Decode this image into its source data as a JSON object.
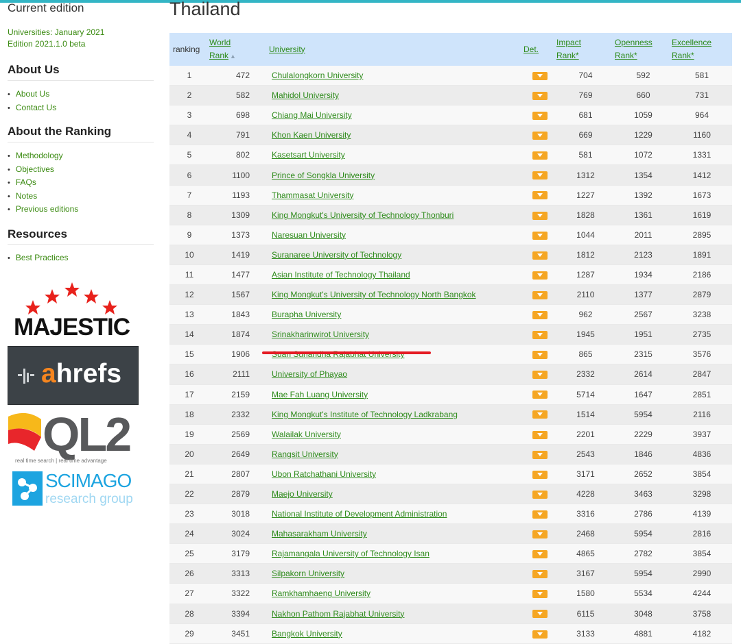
{
  "sidebar": {
    "edition_title": "Current edition",
    "edition_line1": "Universities: January 2021",
    "edition_line2": "Edition 2021.1.0 beta",
    "about_us": {
      "heading": "About Us",
      "items": [
        "About Us",
        "Contact Us"
      ]
    },
    "about_ranking": {
      "heading": "About the Ranking",
      "items": [
        "Methodology",
        "Objectives",
        "FAQs",
        "Notes",
        "Previous editions"
      ]
    },
    "resources": {
      "heading": "Resources",
      "items": [
        "Best Practices"
      ]
    },
    "logos": {
      "majestic": "MAJESTIC",
      "ahrefs_a": "a",
      "ahrefs_rest": "hrefs",
      "ql2": "QL2",
      "ql2_tag": "real time search | real time advantage",
      "scimago_1": "SCIMAGO",
      "scimago_2": "research group"
    }
  },
  "main": {
    "country": "Thailand",
    "headers": {
      "ranking": "ranking",
      "world_1": "World",
      "world_2": "Rank",
      "university": "University",
      "det": "Det.",
      "impact_1": "Impact",
      "impact_2": "Rank*",
      "openness_1": "Openness",
      "openness_2": "Rank*",
      "excellence_1": "Excellence",
      "excellence_2": "Rank*"
    },
    "rows": [
      [
        "1",
        "472",
        "Chulalongkorn University",
        "704",
        "592",
        "581"
      ],
      [
        "2",
        "582",
        "Mahidol University",
        "769",
        "660",
        "731"
      ],
      [
        "3",
        "698",
        "Chiang Mai University",
        "681",
        "1059",
        "964"
      ],
      [
        "4",
        "791",
        "Khon Kaen University",
        "669",
        "1229",
        "1160"
      ],
      [
        "5",
        "802",
        "Kasetsart University",
        "581",
        "1072",
        "1331"
      ],
      [
        "6",
        "1100",
        "Prince of Songkla University",
        "1312",
        "1354",
        "1412"
      ],
      [
        "7",
        "1193",
        "Thammasat University",
        "1227",
        "1392",
        "1673"
      ],
      [
        "8",
        "1309",
        "King Mongkut's University of Technology Thonburi",
        "1828",
        "1361",
        "1619"
      ],
      [
        "9",
        "1373",
        "Naresuan University",
        "1044",
        "2011",
        "2895"
      ],
      [
        "10",
        "1419",
        "Suranaree University of Technology",
        "1812",
        "2123",
        "1891"
      ],
      [
        "11",
        "1477",
        "Asian Institute of Technology Thailand",
        "1287",
        "1934",
        "2186"
      ],
      [
        "12",
        "1567",
        "King Mongkut's University of Technology North Bangkok",
        "2110",
        "1377",
        "2879"
      ],
      [
        "13",
        "1843",
        "Burapha University",
        "962",
        "2567",
        "3238"
      ],
      [
        "14",
        "1874",
        "Srinakharinwirot University",
        "1945",
        "1951",
        "2735"
      ],
      [
        "15",
        "1906",
        "Suan Sunandha Rajabhat University",
        "865",
        "2315",
        "3576"
      ],
      [
        "16",
        "2111",
        "University of Phayao",
        "2332",
        "2614",
        "2847"
      ],
      [
        "17",
        "2159",
        "Mae Fah Luang University",
        "5714",
        "1647",
        "2851"
      ],
      [
        "18",
        "2332",
        "King Mongkut's Institute of Technology Ladkrabang",
        "1514",
        "5954",
        "2116"
      ],
      [
        "19",
        "2569",
        "Walailak University",
        "2201",
        "2229",
        "3937"
      ],
      [
        "20",
        "2649",
        "Rangsit University",
        "2543",
        "1846",
        "4836"
      ],
      [
        "21",
        "2807",
        "Ubon Ratchathani University",
        "3171",
        "2652",
        "3854"
      ],
      [
        "22",
        "2879",
        "Maejo University",
        "4228",
        "3463",
        "3298"
      ],
      [
        "23",
        "3018",
        "National Institute of Development Administration",
        "3316",
        "2786",
        "4139"
      ],
      [
        "24",
        "3024",
        "Mahasarakham University",
        "2468",
        "5954",
        "2816"
      ],
      [
        "25",
        "3179",
        "Rajamangala University of Technology Isan",
        "4865",
        "2782",
        "3854"
      ],
      [
        "26",
        "3313",
        "Silpakorn University",
        "3167",
        "5954",
        "2990"
      ],
      [
        "27",
        "3322",
        "Ramkhamhaeng University",
        "1580",
        "5534",
        "4244"
      ],
      [
        "28",
        "3394",
        "Nakhon Pathom Rajabhat University",
        "6115",
        "3048",
        "3758"
      ],
      [
        "29",
        "3451",
        "Bangkok University",
        "3133",
        "4881",
        "4182"
      ]
    ]
  },
  "colors": {
    "link": "#2e8b1b",
    "header_bg": "#cfe4fb",
    "highlight": "#e41b23",
    "accent_top": "#33b5c5"
  }
}
